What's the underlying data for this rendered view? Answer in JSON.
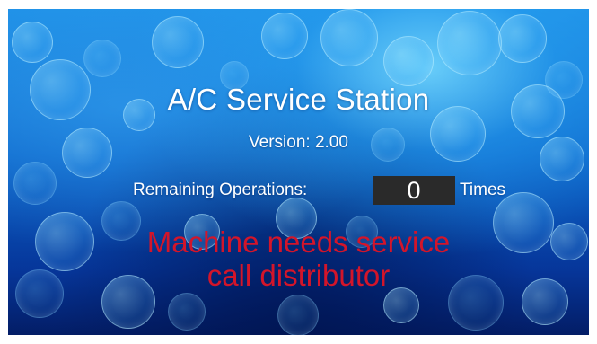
{
  "screen": {
    "title": "A/C Service Station",
    "version_text": "Version: 2.00",
    "remaining_operations": {
      "label": "Remaining Operations:",
      "value": "0",
      "unit": "Times"
    },
    "warning": {
      "line1": "Machine needs service",
      "line2": "call distributor"
    }
  },
  "colors": {
    "background_top": "#1d8fe6",
    "background_bottom": "#031d66",
    "text": "#ffffff",
    "warning_text": "#d3152a",
    "counter_box": "#2a2a2a"
  }
}
